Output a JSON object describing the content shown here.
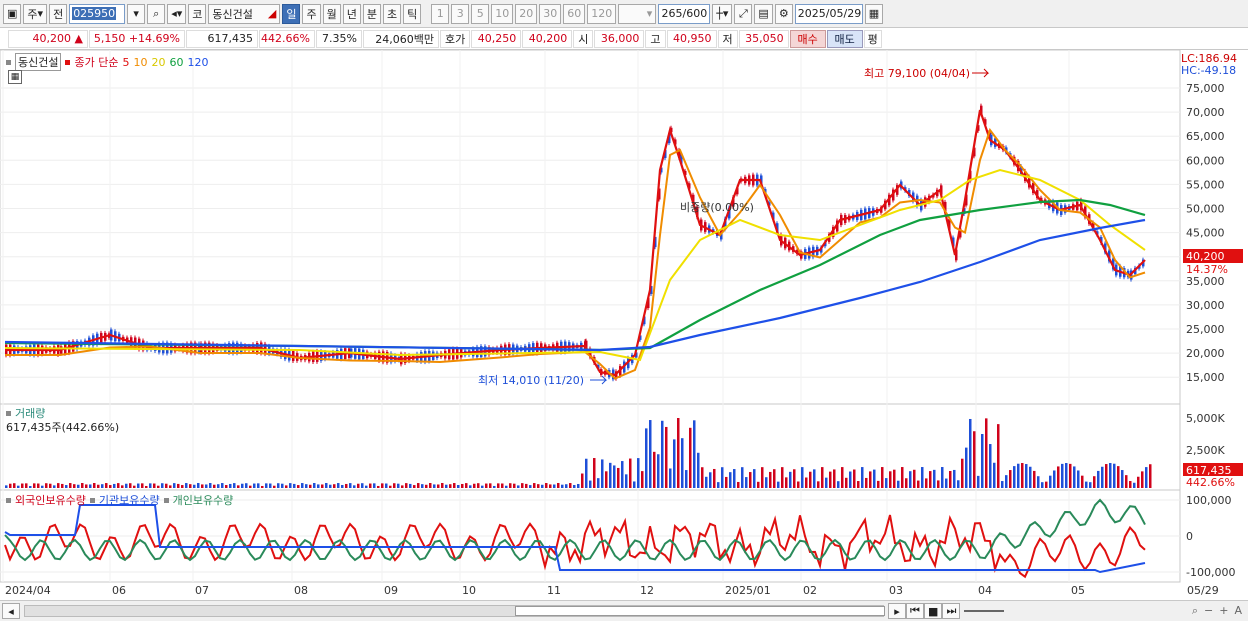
{
  "toolbar": {
    "market": "주",
    "prev": "전",
    "code": "025950",
    "name_prefix": "코",
    "stock_name": "동신건설",
    "periods": [
      "일",
      "주",
      "월",
      "년",
      "분",
      "초",
      "틱"
    ],
    "active_period": "일",
    "intervals": [
      "1",
      "3",
      "5",
      "10",
      "20",
      "30",
      "60",
      "120"
    ],
    "count": "265",
    "count_total": "/600",
    "date": "2025/05/29"
  },
  "info": {
    "price": "40,200",
    "arrow": "▲",
    "change": "5,150",
    "change_pct": "+14.69%",
    "volume": "617,435",
    "volume_pct": "442.66%",
    "turnover_pct": "7.35%",
    "amount": "24,060백만",
    "bid_label": "호가",
    "bid1": "40,250",
    "bid2": "40,200",
    "open_label": "시",
    "open": "36,000",
    "high_label": "고",
    "high": "40,950",
    "low_label": "저",
    "low": "35,050",
    "buy_label": "매수",
    "sell_label": "매도",
    "eval_label": "평"
  },
  "price_pane": {
    "title": "동신건설",
    "legend_main": "종가 단순",
    "ma": [
      {
        "label": "5",
        "color": "#e01010"
      },
      {
        "label": "10",
        "color": "#f08c00"
      },
      {
        "label": "20",
        "color": "#f0e000"
      },
      {
        "label": "60",
        "color": "#10a040"
      },
      {
        "label": "120",
        "color": "#1e50e8"
      }
    ],
    "lc": "LC:186.94",
    "hc": "HC:-49.18",
    "y_ticks": [
      "75,000",
      "70,000",
      "65,000",
      "60,000",
      "55,000",
      "50,000",
      "45,000",
      "40,000",
      "35,000",
      "30,000",
      "25,000",
      "20,000",
      "15,000"
    ],
    "current_price_tag": "40,200",
    "current_pct_tag": "14.37%",
    "high_note": "최고 79,100 (04/04)",
    "low_note": "최저 14,010 (11/20)",
    "mid_note": "비중량(0.00%)"
  },
  "volume_pane": {
    "title": "거래량",
    "value": "617,435주(442.66%)",
    "y_ticks": [
      "5,000K",
      "2,500K"
    ],
    "tag_value": "617,435",
    "tag_pct": "442.66%"
  },
  "holding_pane": {
    "foreign": "외국인보유수량",
    "institution": "기관보유수량",
    "individual": "개인보유수량",
    "y_ticks": [
      "100,000",
      "0",
      "-100,000"
    ]
  },
  "x_axis": [
    "2024/04",
    "06",
    "07",
    "08",
    "09",
    "10",
    "11",
    "12",
    "2025/01",
    "02",
    "03",
    "04",
    "05",
    "05/29"
  ]
}
